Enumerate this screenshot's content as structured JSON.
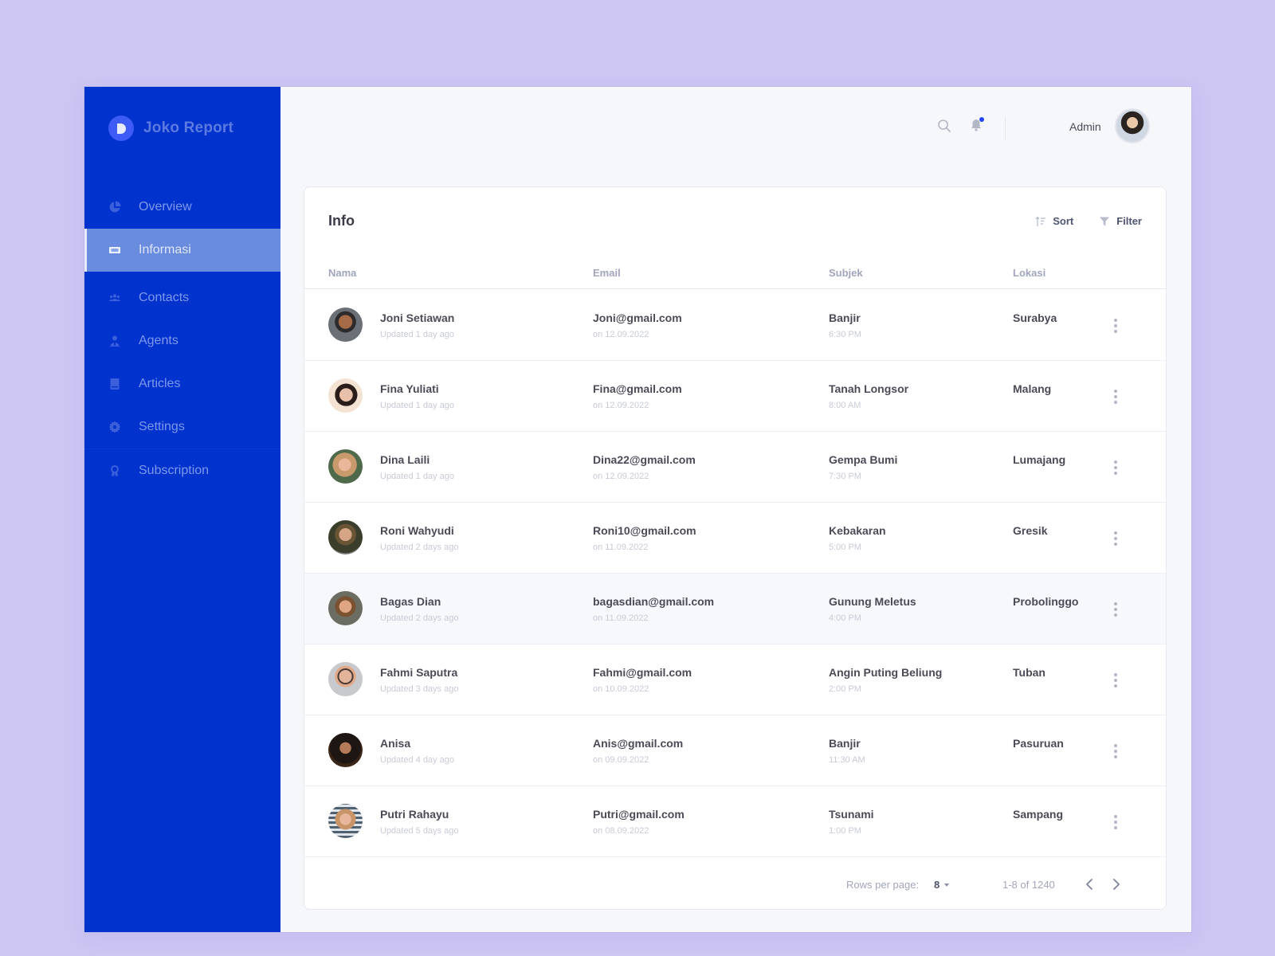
{
  "app": {
    "brand_letter": "D",
    "brand_name": "Joko Report",
    "accent_color": "#0032cd",
    "active_nav_color": "#6a8cdf"
  },
  "sidebar": {
    "items": [
      {
        "label": "Overview",
        "icon": "pie-chart-icon",
        "active": false
      },
      {
        "label": "Informasi",
        "icon": "ticket-icon",
        "active": true
      },
      {
        "label": "Contacts",
        "icon": "users-icon",
        "active": false
      },
      {
        "label": "Agents",
        "icon": "agent-icon",
        "active": false
      },
      {
        "label": "Articles",
        "icon": "book-icon",
        "active": false
      },
      {
        "label": "Settings",
        "icon": "gear-icon",
        "active": false
      },
      {
        "label": "Subscription",
        "icon": "award-icon",
        "active": false
      }
    ]
  },
  "topbar": {
    "search_icon": "search-icon",
    "notification_icon": "bell-icon",
    "has_notification": true,
    "user_name": "Admin"
  },
  "card": {
    "title": "Info",
    "sort_label": "Sort",
    "filter_label": "Filter",
    "columns": [
      "Nama",
      "Email",
      "Subjek",
      "Lokasi"
    ],
    "rows": [
      {
        "name": "Joni Setiawan",
        "updated": "Updated 1 day ago",
        "email": "Joni@gmail.com",
        "date": "on 12.09.2022",
        "subject": "Banjir",
        "time": "6:30 PM",
        "location": "Surabya"
      },
      {
        "name": "Fina Yuliati",
        "updated": "Updated 1 day ago",
        "email": "Fina@gmail.com",
        "date": "on 12.09.2022",
        "subject": "Tanah Longsor",
        "time": "8:00 AM",
        "location": "Malang"
      },
      {
        "name": "Dina Laili",
        "updated": "Updated 1 day ago",
        "email": "Dina22@gmail.com",
        "date": "on 12.09.2022",
        "subject": "Gempa Bumi",
        "time": "7:30 PM",
        "location": "Lumajang"
      },
      {
        "name": "Roni Wahyudi",
        "updated": "Updated 2 days ago",
        "email": "Roni10@gmail.com",
        "date": "on 11.09.2022",
        "subject": "Kebakaran",
        "time": "5:00 PM",
        "location": "Gresik"
      },
      {
        "name": "Bagas Dian",
        "updated": "Updated 2 days ago",
        "email": "bagasdian@gmail.com",
        "date": "on 11.09.2022",
        "subject": "Gunung Meletus",
        "time": "4:00 PM",
        "location": "Probolinggo",
        "highlighted": true
      },
      {
        "name": "Fahmi Saputra",
        "updated": "Updated 3 days ago",
        "email": "Fahmi@gmail.com",
        "date": "on 10.09.2022",
        "subject": "Angin Puting Beliung",
        "time": "2:00 PM",
        "location": "Tuban"
      },
      {
        "name": "Anisa",
        "updated": "Updated 4 day ago",
        "email": "Anis@gmail.com",
        "date": "on 09.09.2022",
        "subject": "Banjir",
        "time": "11:30 AM",
        "location": "Pasuruan"
      },
      {
        "name": "Putri Rahayu",
        "updated": "Updated 5 days ago",
        "email": "Putri@gmail.com",
        "date": "on 08.09.2022",
        "subject": "Tsunami",
        "time": "1:00 PM",
        "location": "Sampang"
      }
    ]
  },
  "pagination": {
    "rows_per_page_label": "Rows per page:",
    "rows_per_page_value": "8",
    "range_text": "1-8 of 1240"
  }
}
